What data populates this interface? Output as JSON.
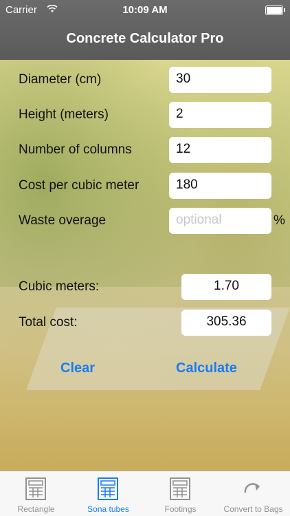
{
  "status_bar": {
    "carrier": "Carrier",
    "time": "10:09 AM"
  },
  "nav": {
    "title": "Concrete Calculator Pro"
  },
  "form": {
    "diameter": {
      "label": "Diameter (cm)",
      "value": "30"
    },
    "height": {
      "label": "Height (meters)",
      "value": "2"
    },
    "columns": {
      "label": "Number of columns",
      "value": "12"
    },
    "cost": {
      "label": "Cost per cubic meter",
      "value": "180"
    },
    "waste": {
      "label": "Waste overage",
      "placeholder": "optional",
      "unit": "%"
    }
  },
  "results": {
    "cubic": {
      "label": "Cubic meters:",
      "value": "1.70"
    },
    "total": {
      "label": "Total cost:",
      "value": "305.36"
    }
  },
  "actions": {
    "clear": "Clear",
    "calculate": "Calculate"
  },
  "tabs": [
    {
      "label": "Rectangle",
      "icon": "calculator-grid-icon"
    },
    {
      "label": "Sona tubes",
      "icon": "calculator-grid-icon"
    },
    {
      "label": "Footings",
      "icon": "calculator-grid-icon"
    },
    {
      "label": "Convert to Bags",
      "icon": "refresh-arrow-icon"
    }
  ],
  "colors": {
    "accent": "#1a7cf2",
    "nav_bar": "#5f5f5f"
  }
}
